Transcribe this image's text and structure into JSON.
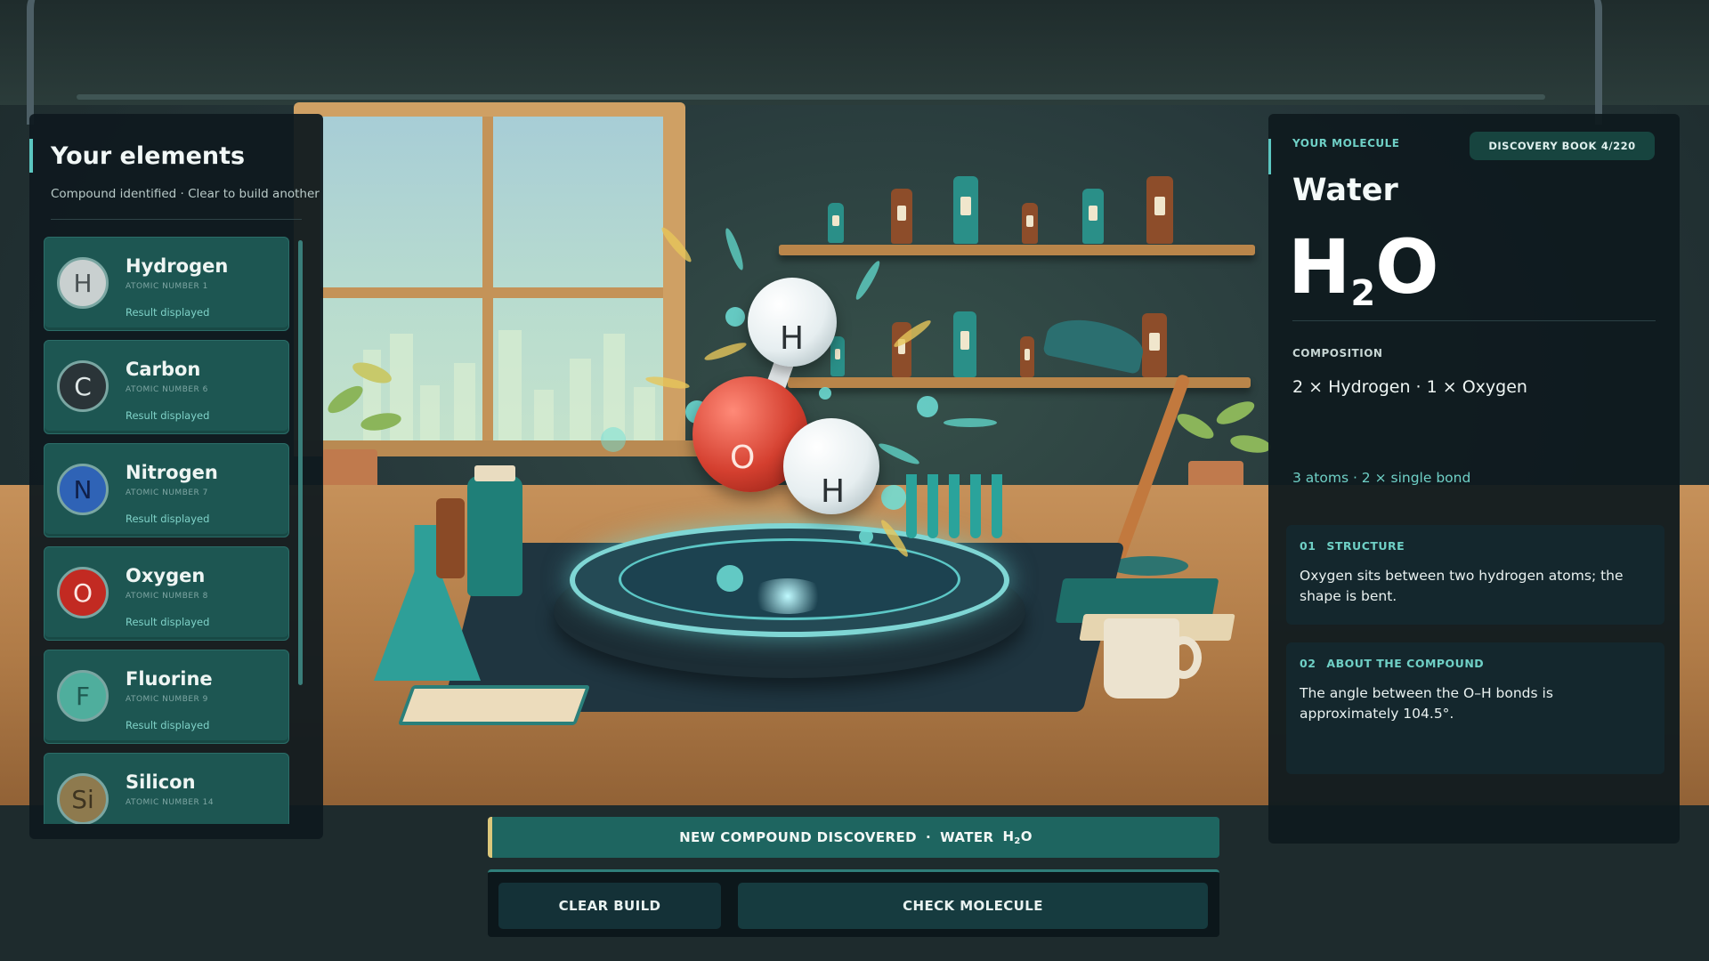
{
  "left_panel": {
    "title": "Your elements",
    "subtitle": "Compound identified · Clear to build another",
    "elements": [
      {
        "symbol": "H",
        "name": "Hydrogen",
        "atomic": "ATOMIC NUMBER 1",
        "status": "Result displayed",
        "color": "#c9d0d0"
      },
      {
        "symbol": "C",
        "name": "Carbon",
        "atomic": "ATOMIC NUMBER 6",
        "status": "Result displayed",
        "color": "#2a3438"
      },
      {
        "symbol": "N",
        "name": "Nitrogen",
        "atomic": "ATOMIC NUMBER 7",
        "status": "Result displayed",
        "color": "#2f63b6"
      },
      {
        "symbol": "O",
        "name": "Oxygen",
        "atomic": "ATOMIC NUMBER 8",
        "status": "Result displayed",
        "color": "#c22a22"
      },
      {
        "symbol": "F",
        "name": "Fluorine",
        "atomic": "ATOMIC NUMBER 9",
        "status": "Result displayed",
        "color": "#4fae9d"
      },
      {
        "symbol": "Si",
        "name": "Silicon",
        "atomic": "ATOMIC NUMBER 14",
        "status": "",
        "color": "#8e7a4e"
      }
    ]
  },
  "right_panel": {
    "label": "YOUR MOLECULE",
    "discovery_label": "DISCOVERY BOOK",
    "discovery_count": "4/220",
    "name": "Water",
    "formula": {
      "a": "H",
      "sub": "2",
      "b": "O"
    },
    "composition_label": "COMPOSITION",
    "composition": "2 × Hydrogen  ·  1 × Oxygen",
    "stats": "3 atoms  ·  2 × single bond",
    "cards": [
      {
        "num": "01",
        "title": "STRUCTURE",
        "body": "Oxygen sits between two hydrogen atoms; the shape is bent."
      },
      {
        "num": "02",
        "title": "ABOUT THE COMPOUND",
        "body": "The angle between the O–H bonds is approximately 104.5°."
      }
    ]
  },
  "scene": {
    "molecule_atoms": [
      "H",
      "O",
      "H"
    ]
  },
  "toast": {
    "prefix": "NEW COMPOUND DISCOVERED",
    "sep": "·",
    "compound": "WATER",
    "formula_a": "H",
    "formula_sub": "2",
    "formula_b": "O"
  },
  "actions": {
    "clear": "CLEAR BUILD",
    "check": "CHECK MOLECULE"
  },
  "colors": {
    "accent": "#5bc6c0",
    "panel": "#0f1a1f",
    "card": "#1d5652",
    "toast": "#1e6560"
  }
}
